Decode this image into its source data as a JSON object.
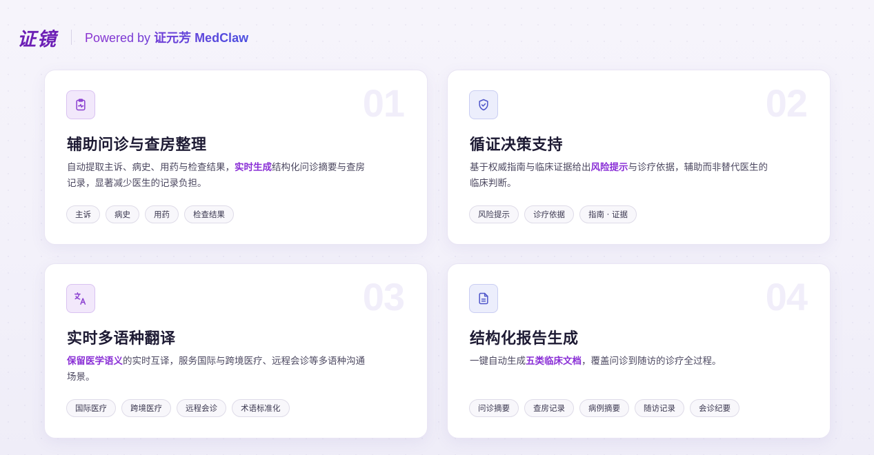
{
  "header": {
    "logo": "证镜",
    "powered_prefix": "Powered by ",
    "powered_brand": "证元芳 MedClaw"
  },
  "colors": {
    "accent": "#8a2fd6",
    "indigo": "#4e55c9",
    "logo": "#6c1fb5"
  },
  "cards": [
    {
      "number": "01",
      "icon": "clipboard-pulse-icon",
      "title": "辅助问诊与查房整理",
      "desc_before": "自动提取主诉、病史、用药与检查结果，",
      "desc_highlight": "实时生成",
      "desc_after": "结构化问诊摘要与查房记录，显著减少医生的记录负担。",
      "tags": [
        "主诉",
        "病史",
        "用药",
        "检查结果"
      ]
    },
    {
      "number": "02",
      "icon": "shield-check-icon",
      "title": "循证决策支持",
      "desc_before": "基于权威指南与临床证据给出",
      "desc_highlight": "风险提示",
      "desc_after": "与诊疗依据，辅助而非替代医生的临床判断。",
      "tags": [
        "风险提示",
        "诊疗依据",
        "指南 · 证据"
      ]
    },
    {
      "number": "03",
      "icon": "translate-icon",
      "title": "实时多语种翻译",
      "desc_before": "",
      "desc_highlight": "保留医学语义",
      "desc_after": "的实时互译，服务国际与跨境医疗、远程会诊等多语种沟通场景。",
      "tags": [
        "国际医疗",
        "跨境医疗",
        "远程会诊",
        "术语标准化"
      ]
    },
    {
      "number": "04",
      "icon": "document-text-icon",
      "title": "结构化报告生成",
      "desc_before": "一键自动生成",
      "desc_highlight": "五类临床文档",
      "desc_after": "，覆盖问诊到随访的诊疗全过程。",
      "tags": [
        "问诊摘要",
        "查房记录",
        "病例摘要",
        "随访记录",
        "会诊纪要"
      ]
    }
  ]
}
